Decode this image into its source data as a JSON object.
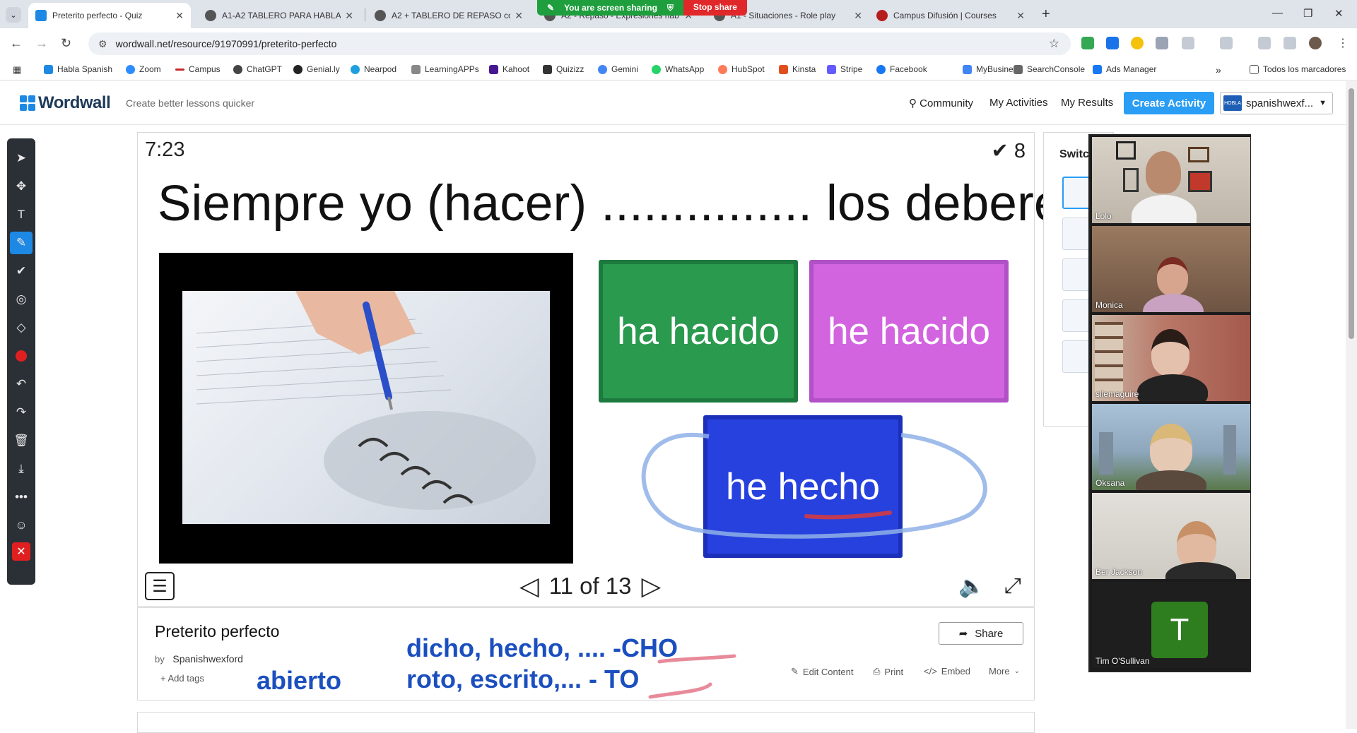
{
  "browser": {
    "tabs": [
      {
        "label": "Preterito perfecto - Quiz",
        "active": true,
        "color": "#1e88e5"
      },
      {
        "label": "A1-A2 TABLERO PARA HABLAR",
        "active": false,
        "color": "#555555"
      },
      {
        "label": "A2 + TABLERO DE REPASO colo",
        "active": false,
        "color": "#555555"
      },
      {
        "label": "A2 - Repaso - Expresiones hab",
        "active": false,
        "color": "#555555"
      },
      {
        "label": "A1 - Situaciones - Role play",
        "active": false,
        "color": "#555555"
      },
      {
        "label": "Campus Difusión | Courses",
        "active": false,
        "color": "#b71c1c"
      }
    ],
    "share_banner": {
      "text": "You are screen sharing",
      "stop": "Stop share"
    },
    "url": "wordwall.net/resource/91970991/preterito-perfecto",
    "bookmarks": [
      {
        "label": "Habla Spanish",
        "color": "#1e88e5"
      },
      {
        "label": "Zoom",
        "color": "#2d8cff"
      },
      {
        "label": "Campus",
        "color": "#c62828"
      },
      {
        "label": "ChatGPT",
        "color": "#444444"
      },
      {
        "label": "Genial.ly",
        "color": "#222222"
      },
      {
        "label": "Nearpod",
        "color": "#1ea0e0"
      },
      {
        "label": "LearningAPPs",
        "color": "#888888"
      },
      {
        "label": "Kahoot",
        "color": "#46178f"
      },
      {
        "label": "Quizizz",
        "color": "#333333"
      },
      {
        "label": "Gemini",
        "color": "#4285f4"
      },
      {
        "label": "WhatsApp",
        "color": "#25d366"
      },
      {
        "label": "HubSpot",
        "color": "#ff7a59"
      },
      {
        "label": "Kinsta",
        "color": "#e04e1b"
      },
      {
        "label": "Stripe",
        "color": "#635bff"
      },
      {
        "label": "Facebook",
        "color": "#1877f2"
      },
      {
        "label": "MyBusiness",
        "color": "#4285f4"
      },
      {
        "label": "SearchConsole",
        "color": "#666666"
      },
      {
        "label": "Ads Manager",
        "color": "#1877f2"
      }
    ],
    "all_bookmarks": "Todos los marcadores"
  },
  "wordwall": {
    "brand": "Wordwall",
    "tagline": "Create better lessons quicker",
    "nav": {
      "community": "Community",
      "activities": "My Activities",
      "results": "My Results"
    },
    "create": "Create Activity",
    "user": "spanishwexf...",
    "user_badge": "HOBLA"
  },
  "quiz": {
    "timer": "7:23",
    "score_icon": "✔",
    "score": "8",
    "question": "Siempre yo (hacer) ............... los deberes.",
    "answers": [
      {
        "label": "ha hacido",
        "color": "#2a9a4e"
      },
      {
        "label": "he hacido",
        "color": "#d264e0"
      },
      {
        "label": "he hecho",
        "color": "#2741de"
      }
    ],
    "pager": "11 of 13"
  },
  "info": {
    "title": "Preterito perfecto",
    "by": "by",
    "author": "Spanishwexford",
    "add_tags": "Add tags",
    "share": "Share",
    "edit": "Edit Content",
    "print": "Print",
    "embed": "Embed",
    "more": "More"
  },
  "annotations": {
    "line1": "dicho, hecho, .... -CHO",
    "line2": "roto, escrito,...  - TO",
    "word": "abierto"
  },
  "switch_panel": {
    "title": "Switc"
  },
  "participants": [
    {
      "name": "Lolo",
      "bg": "#c9c2b8",
      "skin": "#b98a6e",
      "speaking": false
    },
    {
      "name": "Monica",
      "bg": "#8a6e58",
      "skin": "#d7a58d",
      "speaking": true
    },
    {
      "name": "silemaguire",
      "bg": "#b27060",
      "skin": "#e3c1ac",
      "speaking": false
    },
    {
      "name": "Oksana",
      "bg": "#9bb3c9",
      "skin": "#e6c9b3",
      "speaking": false
    },
    {
      "name": "Ber Jackson",
      "bg": "#d8d5d0",
      "skin": "#e0b9a0",
      "speaking": false
    },
    {
      "name": "Tim O'Sullivan",
      "initial": "T",
      "avatar_color": "#2e7d1f"
    }
  ]
}
